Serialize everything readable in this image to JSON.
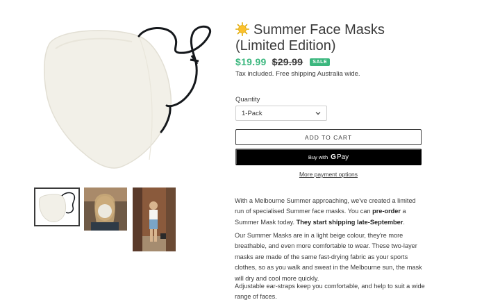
{
  "product": {
    "title": "Summer Face Masks (Limited Edition)",
    "emoji_icon": "sun-icon",
    "price": "$19.99",
    "compare_price": "$29.99",
    "badge": "SALE",
    "tax_note": "Tax included. Free shipping Australia wide."
  },
  "form": {
    "quantity_label": "Quantity",
    "quantity_selected": "1-Pack",
    "add_to_cart": "ADD TO CART",
    "buy_with": "Buy with",
    "gpay_g": "G",
    "gpay_pay": "Pay",
    "more_payment": "More payment options"
  },
  "description": {
    "p1_a": "With a Melbourne Summer approaching, we've created a limited run of specialised Summer face masks. You can ",
    "p1_b": "pre-order",
    "p1_c": " a Summer Mask today. ",
    "p1_d": "They start shipping late-September",
    "p1_e": ".",
    "p2": "Our Summer Masks are in a light beige colour, they're more breathable, and even more comfortable to wear. These two-layer masks are made of the same fast-drying fabric as your sports clothes, so as you walk and sweat in the Melbourne sun, the mask will dry and cool more quickly.",
    "p3": "Adjustable ear-straps keep you comfortable, and help to suit a wide range of faces."
  },
  "colors": {
    "price_green": "#3bb77e",
    "text": "#3a3a3a",
    "button_black": "#000000"
  }
}
